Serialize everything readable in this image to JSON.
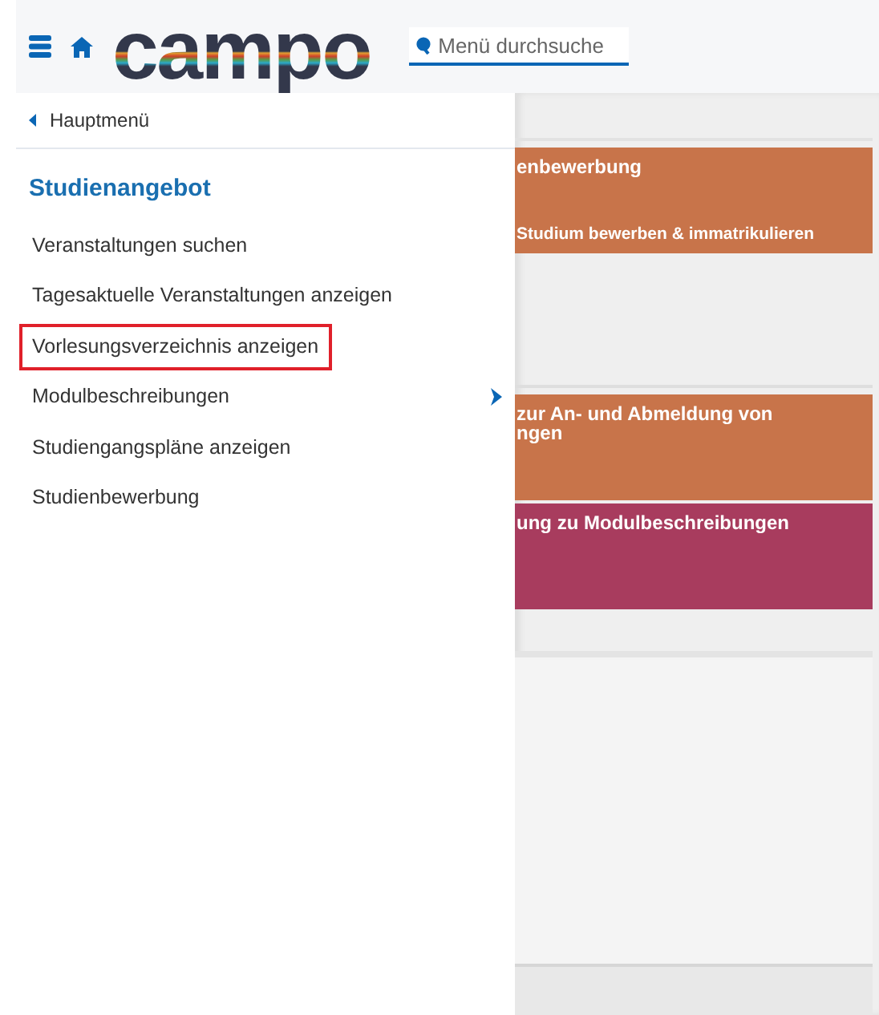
{
  "header": {
    "logo": "campo",
    "search": {
      "placeholder": "Menü durchsuche"
    }
  },
  "menu": {
    "back": "Hauptmenü",
    "title": "Studienangebot",
    "items": [
      {
        "label": "Veranstaltungen suchen",
        "highlighted": false,
        "has_children": false
      },
      {
        "label": "Tagesaktuelle Veranstaltungen anzeigen",
        "highlighted": false,
        "has_children": false
      },
      {
        "label": "Vorlesungsverzeichnis anzeigen",
        "highlighted": true,
        "has_children": false
      },
      {
        "label": "Modulbeschreibungen",
        "highlighted": false,
        "has_children": true
      },
      {
        "label": "Studiengangspläne anzeigen",
        "highlighted": false,
        "has_children": false
      },
      {
        "label": "Studienbewerbung",
        "highlighted": false,
        "has_children": false
      }
    ]
  },
  "tiles": [
    {
      "title": "enbewerbung",
      "subtitle": "Studium bewerben & immatrikulieren",
      "color": "#c8744a"
    },
    {
      "title": "zur An- und Abmeldung von\nngen",
      "color": "#c8744a"
    },
    {
      "title": "ung zu Modulbeschreibungen",
      "color": "#a83c5e"
    }
  ]
}
